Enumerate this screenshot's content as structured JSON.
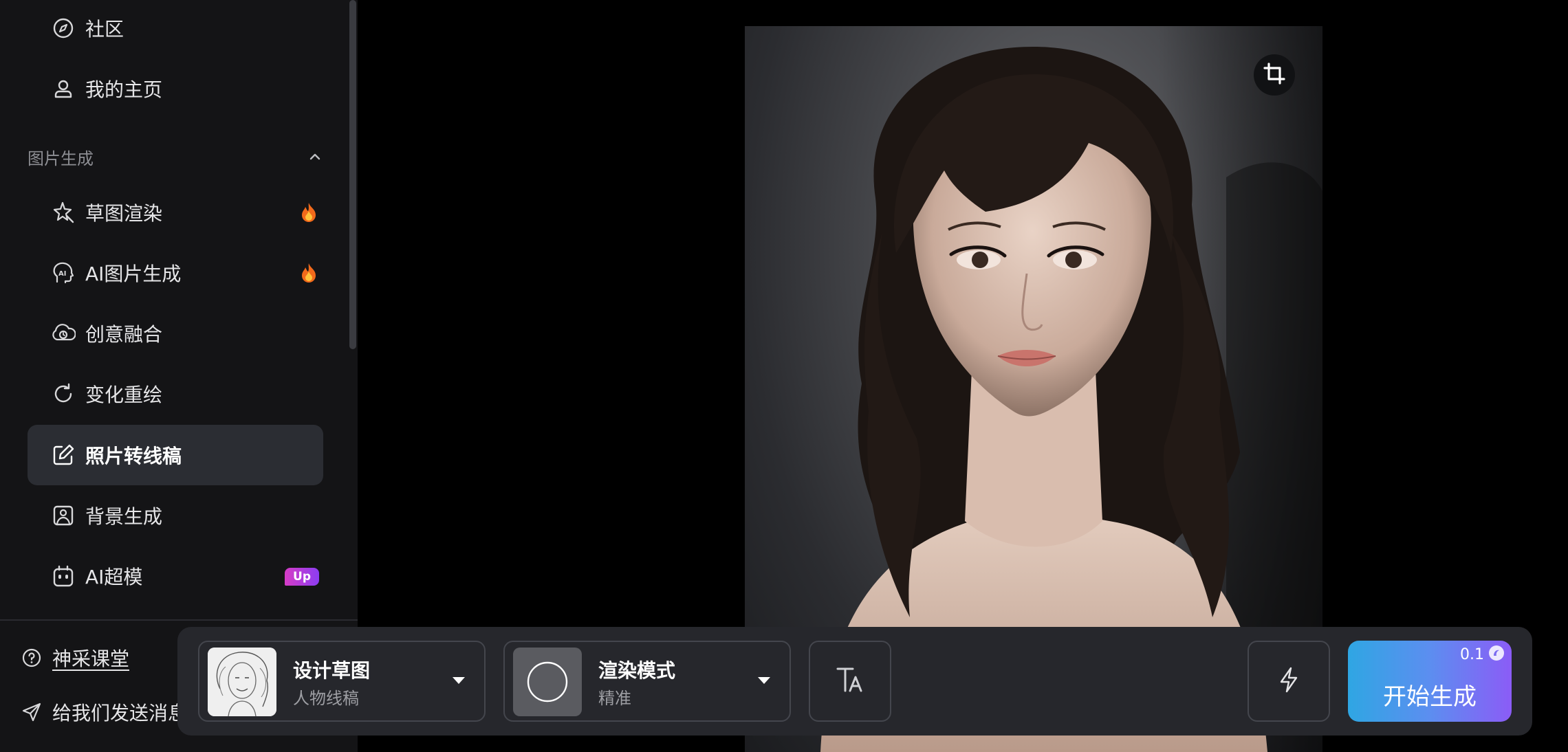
{
  "sidebar": {
    "top_items": [
      {
        "label": "社区",
        "icon": "compass-icon"
      },
      {
        "label": "我的主页",
        "icon": "user-icon"
      }
    ],
    "section_title": "图片生成",
    "items": [
      {
        "label": "草图渲染",
        "icon": "sparkle-pen-icon",
        "badge": "hot"
      },
      {
        "label": "AI图片生成",
        "icon": "ai-head-icon",
        "badge": "hot"
      },
      {
        "label": "创意融合",
        "icon": "blend-cloud-icon"
      },
      {
        "label": "变化重绘",
        "icon": "refresh-icon"
      },
      {
        "label": "照片转线稿",
        "icon": "edit-square-icon",
        "active": true
      },
      {
        "label": "背景生成",
        "icon": "image-icon"
      },
      {
        "label": "AI超模",
        "icon": "robot-icon",
        "badge_text": "Up"
      }
    ],
    "footer": {
      "course": "神采课堂",
      "feedback": "给我们发送消息"
    }
  },
  "canvas": {
    "image_alt": "portrait photo",
    "crop_icon": "crop-icon"
  },
  "toolbar": {
    "sketch": {
      "title": "设计草图",
      "subtitle": "人物线稿"
    },
    "render": {
      "title": "渲染模式",
      "subtitle": "精准"
    },
    "text_icon": "text-size-icon",
    "flash_icon": "lightning-icon",
    "generate": {
      "label": "开始生成",
      "cost": "0.1"
    }
  },
  "colors": {
    "active_bg": "#2b2d33",
    "fire": "#f7862b",
    "up_badge": "#c23ed4",
    "generate_start": "#2fa6e3",
    "generate_end": "#8b5cf6"
  }
}
